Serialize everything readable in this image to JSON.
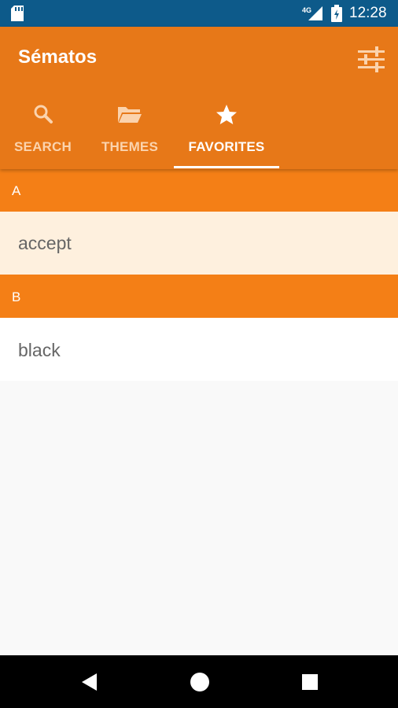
{
  "status_bar": {
    "time": "12:28",
    "network_label": "4G",
    "icons": [
      "sd-card-icon",
      "signal-icon",
      "battery-icon"
    ]
  },
  "app_bar": {
    "title": "Sématos",
    "settings_icon": "sliders-icon",
    "background_color": "#e77818"
  },
  "tabs": [
    {
      "label": "SEARCH",
      "icon": "search-icon",
      "active": false
    },
    {
      "label": "THEMES",
      "icon": "folder-icon",
      "active": false
    },
    {
      "label": "FAVORITES",
      "icon": "star-icon",
      "active": true
    }
  ],
  "sections": [
    {
      "header": "A",
      "items": [
        {
          "label": "accept",
          "highlighted": true
        }
      ]
    },
    {
      "header": "B",
      "items": [
        {
          "label": "black",
          "highlighted": false
        }
      ]
    }
  ],
  "nav_bar": {
    "buttons": [
      "back-icon",
      "home-icon",
      "recents-icon"
    ]
  },
  "colors": {
    "status_bar": "#0d5a8a",
    "accent": "#f47f16",
    "highlight_row": "#fef0de",
    "list_text": "#666666"
  }
}
